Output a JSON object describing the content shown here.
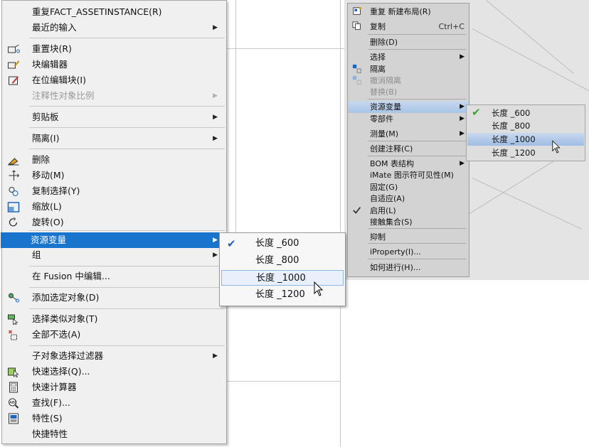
{
  "left_menu": {
    "items": [
      {
        "label": "重复FACT_ASSETINSTANCE(R)",
        "icon": "",
        "arrow": false,
        "disabled": false
      },
      {
        "label": "最近的输入",
        "icon": "",
        "arrow": true,
        "disabled": false
      },
      {
        "label": "重置块(R)",
        "icon": "reset-block-icon",
        "arrow": false,
        "disabled": false
      },
      {
        "label": "块编辑器",
        "icon": "block-editor-icon",
        "arrow": false,
        "disabled": false
      },
      {
        "label": "在位编辑块(I)",
        "icon": "edit-in-place-icon",
        "arrow": false,
        "disabled": false
      },
      {
        "label": "注释性对象比例",
        "icon": "",
        "arrow": true,
        "disabled": true
      },
      {
        "label": "剪贴板",
        "icon": "",
        "arrow": true,
        "disabled": false
      },
      {
        "label": "隔离(I)",
        "icon": "",
        "arrow": true,
        "disabled": false
      },
      {
        "label": "删除",
        "icon": "erase-icon",
        "arrow": false,
        "disabled": false
      },
      {
        "label": "移动(M)",
        "icon": "move-icon",
        "arrow": false,
        "disabled": false
      },
      {
        "label": "复制选择(Y)",
        "icon": "copy-selection-icon",
        "arrow": false,
        "disabled": false
      },
      {
        "label": "缩放(L)",
        "icon": "scale-icon",
        "arrow": false,
        "disabled": false
      },
      {
        "label": "旋转(O)",
        "icon": "rotate-icon",
        "arrow": false,
        "disabled": false
      },
      {
        "label": "资源变量",
        "icon": "",
        "arrow": true,
        "disabled": false,
        "highlighted": true
      },
      {
        "label": "组",
        "icon": "",
        "arrow": true,
        "disabled": false
      },
      {
        "label": "在 Fusion 中编辑...",
        "icon": "",
        "arrow": false,
        "disabled": false
      },
      {
        "label": "添加选定对象(D)",
        "icon": "add-selected-icon",
        "arrow": false,
        "disabled": false
      },
      {
        "label": "选择类似对象(T)",
        "icon": "select-similar-icon",
        "arrow": false,
        "disabled": false
      },
      {
        "label": "全部不选(A)",
        "icon": "deselect-all-icon",
        "arrow": false,
        "disabled": false
      },
      {
        "label": "子对象选择过滤器",
        "icon": "",
        "arrow": true,
        "disabled": false
      },
      {
        "label": "快速选择(Q)...",
        "icon": "quick-select-icon",
        "arrow": false,
        "disabled": false
      },
      {
        "label": "快速计算器",
        "icon": "calculator-icon",
        "arrow": false,
        "disabled": false
      },
      {
        "label": "查找(F)...",
        "icon": "find-icon",
        "arrow": false,
        "disabled": false
      },
      {
        "label": "特性(S)",
        "icon": "properties-icon",
        "arrow": false,
        "disabled": false
      },
      {
        "label": "快捷特性",
        "icon": "",
        "arrow": false,
        "disabled": false
      }
    ],
    "submenu": [
      {
        "label": "长度 _600",
        "checked": true,
        "hover": false
      },
      {
        "label": "长度 _800",
        "checked": false,
        "hover": false
      },
      {
        "label": "长度 _1000",
        "checked": false,
        "hover": true
      },
      {
        "label": "长度 _1200",
        "checked": false,
        "hover": false
      }
    ]
  },
  "right_menu": {
    "items": [
      {
        "label": "重复 新建布局(R)",
        "icon": "new-layout-icon",
        "arrow": false,
        "disabled": false,
        "shortcut": ""
      },
      {
        "label": "复制",
        "icon": "copy-icon",
        "arrow": false,
        "disabled": false,
        "shortcut": "Ctrl+C"
      },
      {
        "label": "删除(D)",
        "icon": "",
        "arrow": false,
        "disabled": false,
        "shortcut": ""
      },
      {
        "label": "选择",
        "icon": "",
        "arrow": true,
        "disabled": false,
        "shortcut": ""
      },
      {
        "label": "隔离",
        "icon": "isolate-icon",
        "arrow": false,
        "disabled": false,
        "shortcut": ""
      },
      {
        "label": "撤消隔离",
        "icon": "undo-isolate-icon",
        "arrow": false,
        "disabled": true,
        "shortcut": ""
      },
      {
        "label": "替换(B)",
        "icon": "",
        "arrow": false,
        "disabled": true,
        "shortcut": ""
      },
      {
        "label": "资源变量",
        "icon": "",
        "arrow": true,
        "disabled": false,
        "shortcut": "",
        "highlighted": true
      },
      {
        "label": "零部件",
        "icon": "",
        "arrow": true,
        "disabled": false,
        "shortcut": ""
      },
      {
        "label": "测量(M)",
        "icon": "",
        "arrow": true,
        "disabled": false,
        "shortcut": ""
      },
      {
        "label": "创建注释(C)",
        "icon": "",
        "arrow": false,
        "disabled": false,
        "shortcut": ""
      },
      {
        "label": "BOM 表结构",
        "icon": "",
        "arrow": true,
        "disabled": false,
        "shortcut": ""
      },
      {
        "label": "iMate 图示符可见性(M)",
        "icon": "",
        "arrow": false,
        "disabled": false,
        "shortcut": ""
      },
      {
        "label": "固定(G)",
        "icon": "",
        "arrow": false,
        "disabled": false,
        "shortcut": ""
      },
      {
        "label": "自适应(A)",
        "icon": "",
        "arrow": false,
        "disabled": false,
        "shortcut": ""
      },
      {
        "label": "启用(L)",
        "icon": "checkmark-icon",
        "arrow": false,
        "disabled": false,
        "shortcut": ""
      },
      {
        "label": "接触集合(S)",
        "icon": "",
        "arrow": false,
        "disabled": false,
        "shortcut": ""
      },
      {
        "label": "抑制",
        "icon": "",
        "arrow": false,
        "disabled": false,
        "shortcut": ""
      },
      {
        "label": "iProperty(I)...",
        "icon": "",
        "arrow": false,
        "disabled": false,
        "shortcut": ""
      },
      {
        "label": "如何进行(H)...",
        "icon": "",
        "arrow": false,
        "disabled": false,
        "shortcut": ""
      }
    ],
    "submenu": [
      {
        "label": "长度 _600",
        "checked": true,
        "hover": false
      },
      {
        "label": "长度 _800",
        "checked": false,
        "hover": false
      },
      {
        "label": "长度 _1000",
        "checked": false,
        "hover": true
      },
      {
        "label": "长度 _1200",
        "checked": false,
        "hover": false
      }
    ]
  },
  "glyphs": {
    "arrow": "▶",
    "check": "✔"
  }
}
